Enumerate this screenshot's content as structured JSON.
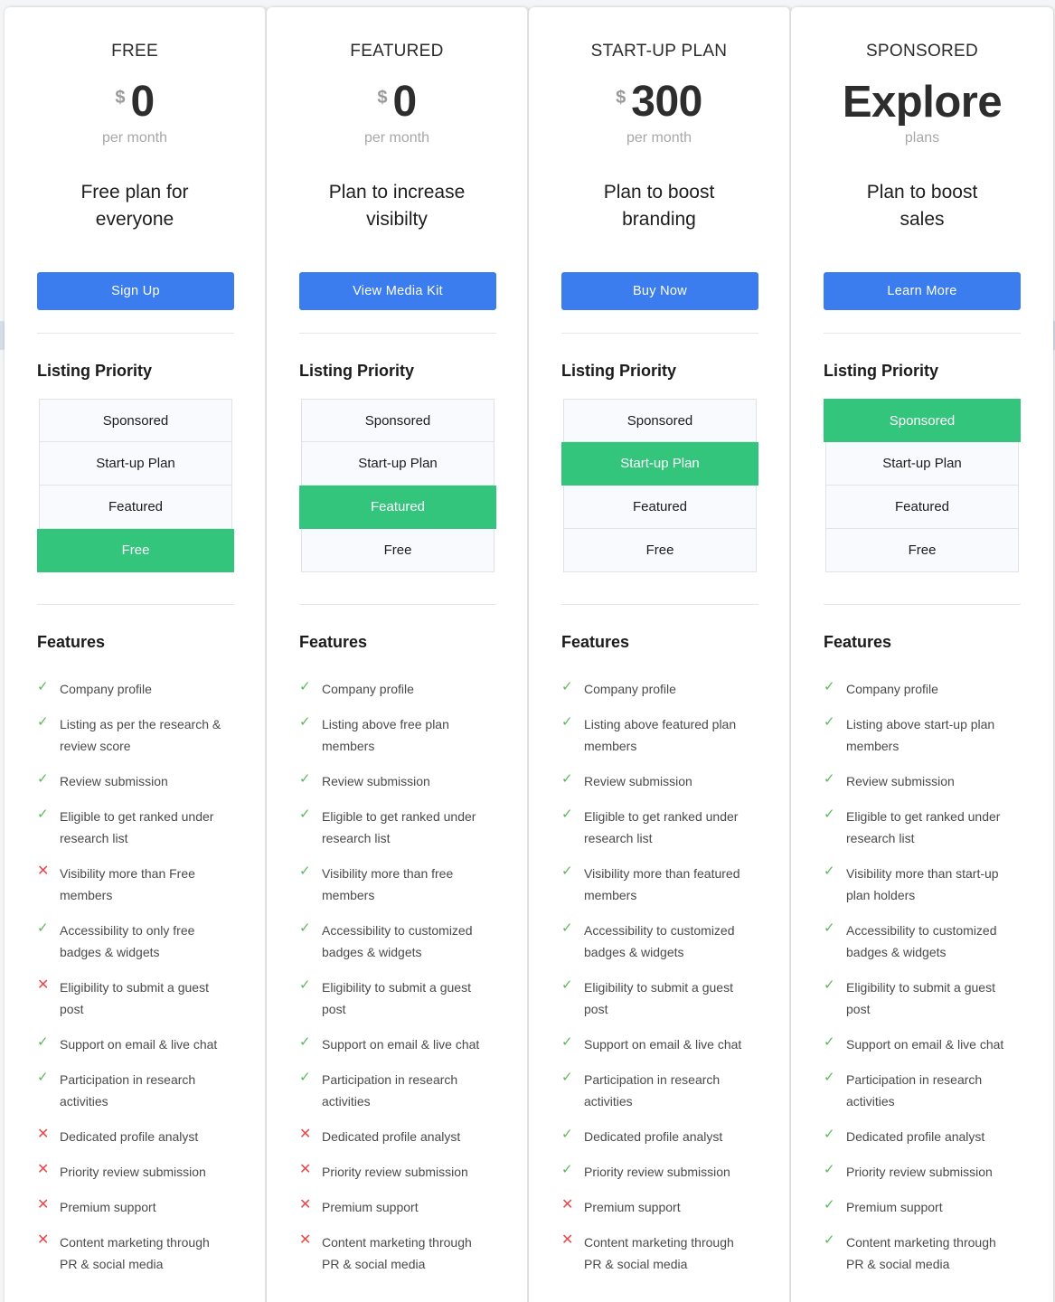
{
  "colors": {
    "accent": "#3b7cef",
    "highlight": "#33c57b",
    "check": "#5cb85c",
    "cross": "#e8484a"
  },
  "icons": {
    "included": "check-icon",
    "excluded": "cross-icon"
  },
  "priority_title": "Listing Priority",
  "features_title": "Features",
  "plans": [
    {
      "name": "FREE",
      "currency": "$",
      "price": "0",
      "period": "per month",
      "tagline": "Free plan for everyone",
      "cta": "Sign Up",
      "priority": [
        {
          "label": "Sponsored",
          "active": false
        },
        {
          "label": "Start-up Plan",
          "active": false
        },
        {
          "label": "Featured",
          "active": false
        },
        {
          "label": "Free",
          "active": true
        }
      ],
      "features": [
        {
          "text": "Company profile",
          "included": true
        },
        {
          "text": "Listing as per the research & review score",
          "included": true
        },
        {
          "text": "Review submission",
          "included": true
        },
        {
          "text": "Eligible to get ranked under research list",
          "included": true
        },
        {
          "text": "Visibility more than Free members",
          "included": false
        },
        {
          "text": "Accessibility to only free badges & widgets",
          "included": true
        },
        {
          "text": "Eligibility to submit a guest post",
          "included": false
        },
        {
          "text": "Support on email & live chat",
          "included": true
        },
        {
          "text": "Participation in research activities",
          "included": true
        },
        {
          "text": "Dedicated profile analyst",
          "included": false
        },
        {
          "text": "Priority review submission",
          "included": false
        },
        {
          "text": "Premium support",
          "included": false
        },
        {
          "text": "Content marketing through PR & social media",
          "included": false
        }
      ]
    },
    {
      "name": "FEATURED",
      "currency": "$",
      "price": "0",
      "period": "per month",
      "tagline": "Plan to increase visibilty",
      "cta": "View Media Kit",
      "priority": [
        {
          "label": "Sponsored",
          "active": false
        },
        {
          "label": "Start-up Plan",
          "active": false
        },
        {
          "label": "Featured",
          "active": true
        },
        {
          "label": "Free",
          "active": false
        }
      ],
      "features": [
        {
          "text": "Company profile",
          "included": true
        },
        {
          "text": "Listing above free plan members",
          "included": true
        },
        {
          "text": "Review submission",
          "included": true
        },
        {
          "text": "Eligible to get ranked under research list",
          "included": true
        },
        {
          "text": "Visibility more than free members",
          "included": true
        },
        {
          "text": "Accessibility to customized badges & widgets",
          "included": true
        },
        {
          "text": "Eligibility to submit a guest post",
          "included": true
        },
        {
          "text": "Support on email & live chat",
          "included": true
        },
        {
          "text": "Participation in research activities",
          "included": true
        },
        {
          "text": "Dedicated profile analyst",
          "included": false
        },
        {
          "text": "Priority review submission",
          "included": false
        },
        {
          "text": "Premium support",
          "included": false
        },
        {
          "text": "Content marketing through PR & social media",
          "included": false
        }
      ]
    },
    {
      "name": "START-UP PLAN",
      "currency": "$",
      "price": "300",
      "period": "per month",
      "tagline": "Plan to boost branding",
      "cta": "Buy Now",
      "priority": [
        {
          "label": "Sponsored",
          "active": false
        },
        {
          "label": "Start-up Plan",
          "active": true
        },
        {
          "label": "Featured",
          "active": false
        },
        {
          "label": "Free",
          "active": false
        }
      ],
      "features": [
        {
          "text": "Company profile",
          "included": true
        },
        {
          "text": "Listing above featured plan members",
          "included": true
        },
        {
          "text": "Review submission",
          "included": true
        },
        {
          "text": "Eligible to get ranked under research list",
          "included": true
        },
        {
          "text": "Visibility more than featured members",
          "included": true
        },
        {
          "text": "Accessibility to customized badges & widgets",
          "included": true
        },
        {
          "text": "Eligibility to submit a guest post",
          "included": true
        },
        {
          "text": "Support on email & live chat",
          "included": true
        },
        {
          "text": "Participation in research activities",
          "included": true
        },
        {
          "text": "Dedicated profile analyst",
          "included": true
        },
        {
          "text": "Priority review submission",
          "included": true
        },
        {
          "text": "Premium support",
          "included": false
        },
        {
          "text": "Content marketing through PR & social media",
          "included": false
        }
      ]
    },
    {
      "name": "SPONSORED",
      "currency": "",
      "price": "Explore",
      "period": "plans",
      "tagline": "Plan to boost sales",
      "cta": "Learn More",
      "priority": [
        {
          "label": "Sponsored",
          "active": true
        },
        {
          "label": "Start-up Plan",
          "active": false
        },
        {
          "label": "Featured",
          "active": false
        },
        {
          "label": "Free",
          "active": false
        }
      ],
      "features": [
        {
          "text": "Company profile",
          "included": true
        },
        {
          "text": "Listing above start-up plan members",
          "included": true
        },
        {
          "text": "Review submission",
          "included": true
        },
        {
          "text": "Eligible to get ranked under research list",
          "included": true
        },
        {
          "text": "Visibility more than start-up plan holders",
          "included": true
        },
        {
          "text": "Accessibility to customized badges & widgets",
          "included": true
        },
        {
          "text": "Eligibility to submit a guest post",
          "included": true
        },
        {
          "text": "Support on email & live chat",
          "included": true
        },
        {
          "text": "Participation in research activities",
          "included": true
        },
        {
          "text": "Dedicated profile analyst",
          "included": true
        },
        {
          "text": "Priority review submission",
          "included": true
        },
        {
          "text": "Premium support",
          "included": true
        },
        {
          "text": "Content marketing through PR & social media",
          "included": true
        }
      ]
    }
  ]
}
